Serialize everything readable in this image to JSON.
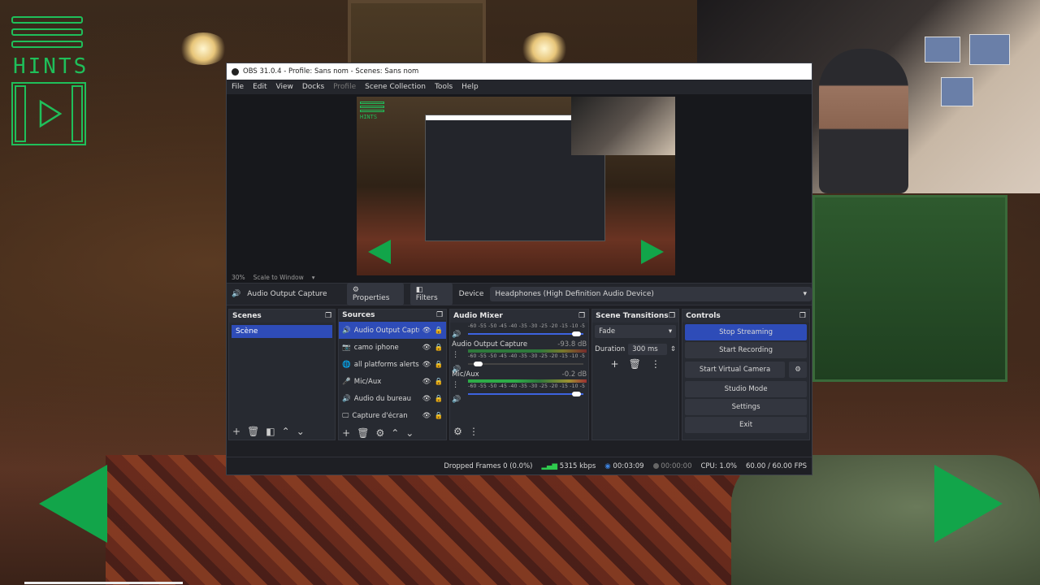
{
  "overlay": {
    "hints_label": "HINTS"
  },
  "window": {
    "title": "OBS 31.0.4 - Profile: Sans nom - Scenes: Sans nom"
  },
  "menu": [
    "File",
    "Edit",
    "View",
    "Docks",
    "Profile",
    "Scene Collection",
    "Tools",
    "Help"
  ],
  "preview": {
    "zoom": "30%",
    "scale_mode": "Scale to Window"
  },
  "source_bar": {
    "source_name": "Audio Output Capture",
    "properties_label": "Properties",
    "filters_label": "Filters",
    "device_label": "Device",
    "device_value": "Headphones (High Definition Audio Device)"
  },
  "scenes": {
    "title": "Scenes",
    "items": [
      "Scène"
    ]
  },
  "sources": {
    "title": "Sources",
    "items": [
      {
        "name": "Audio Output Capture",
        "selected": true,
        "icon": "speaker-icon"
      },
      {
        "name": "camo iphone",
        "selected": false,
        "icon": "camera-icon"
      },
      {
        "name": "all platforms alerts",
        "selected": false,
        "icon": "globe-icon"
      },
      {
        "name": "Mic/Aux",
        "selected": false,
        "icon": "mic-icon"
      },
      {
        "name": "Audio du bureau",
        "selected": false,
        "icon": "speaker-icon"
      },
      {
        "name": "Capture d'écran",
        "selected": false,
        "icon": "monitor-icon"
      }
    ]
  },
  "mixer": {
    "title": "Audio Mixer",
    "ticks": "-60 -55 -50 -45 -40 -35 -30 -25 -20 -15 -10 -5 0",
    "channels": [
      {
        "name": "",
        "db": "",
        "fader_level": 0.95
      },
      {
        "name": "Audio Output Capture",
        "db": "-93.8 dB",
        "fader_level": 0.05
      },
      {
        "name": "Mic/Aux",
        "db": "-0.2 dB",
        "fader_level": 0.95
      }
    ]
  },
  "transitions": {
    "title": "Scene Transitions",
    "type": "Fade",
    "duration_label": "Duration",
    "duration_value": "300 ms"
  },
  "controls": {
    "title": "Controls",
    "stop_streaming": "Stop Streaming",
    "start_recording": "Start Recording",
    "start_virtual_camera": "Start Virtual Camera",
    "studio_mode": "Studio Mode",
    "settings": "Settings",
    "exit": "Exit"
  },
  "status": {
    "dropped_frames": "Dropped Frames 0 (0.0%)",
    "bitrate": "5315 kbps",
    "stream_time": "00:03:09",
    "record_time": "00:00:00",
    "cpu": "CPU: 1.0%",
    "fps": "60.00 / 60.00 FPS"
  },
  "colors": {
    "accent": "#2e4cb8",
    "hint_green": "#1fbf5a",
    "arrow_green": "#12a54a"
  }
}
